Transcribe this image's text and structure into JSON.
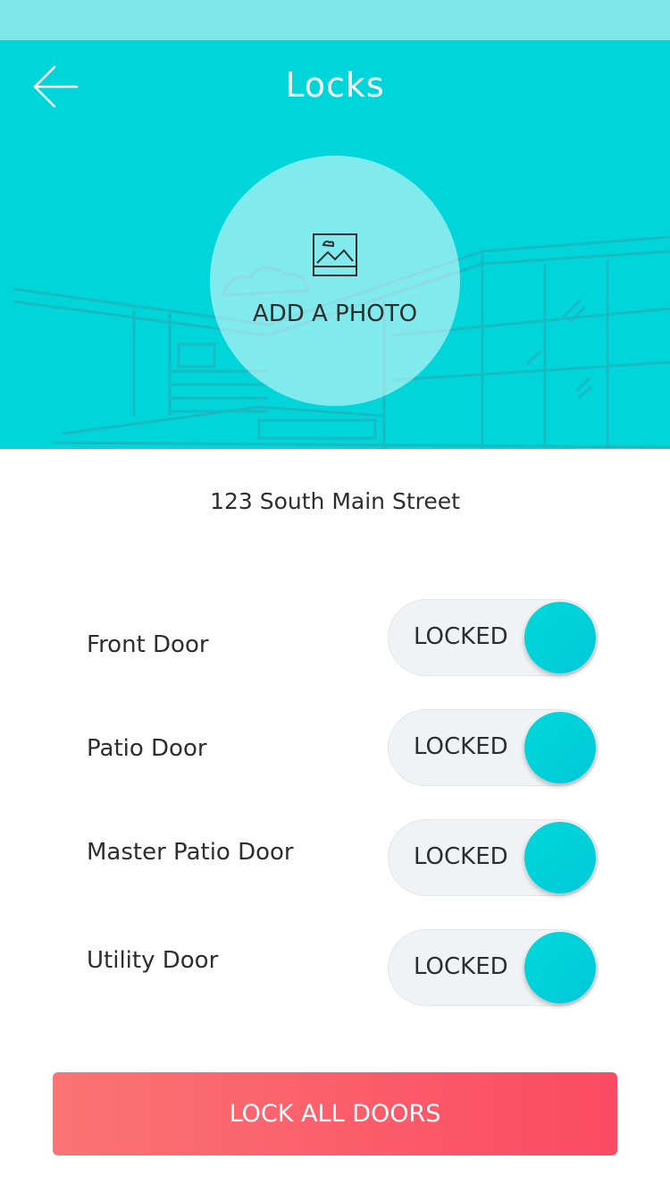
{
  "header": {
    "title": "Locks",
    "back_icon": "arrow-left-icon"
  },
  "photo": {
    "label": "ADD A PHOTO",
    "icon": "image-icon"
  },
  "address": "123 South Main Street",
  "locks": [
    {
      "name": "Front Door",
      "state_label": "LOCKED",
      "locked": true
    },
    {
      "name": "Patio Door",
      "state_label": "LOCKED",
      "locked": true
    },
    {
      "name": "Master Patio Door",
      "state_label": "LOCKED",
      "locked": true
    },
    {
      "name": "Utility Door",
      "state_label": "LOCKED",
      "locked": true
    }
  ],
  "actions": {
    "lock_all_label": "LOCK ALL DOORS"
  },
  "colors": {
    "header_bg": "#00d5d9",
    "status_bar": "#7de6e6",
    "toggle_knob": "#00d2d9",
    "button_gradient_start": "#fb7474",
    "button_gradient_end": "#fb4a63"
  }
}
